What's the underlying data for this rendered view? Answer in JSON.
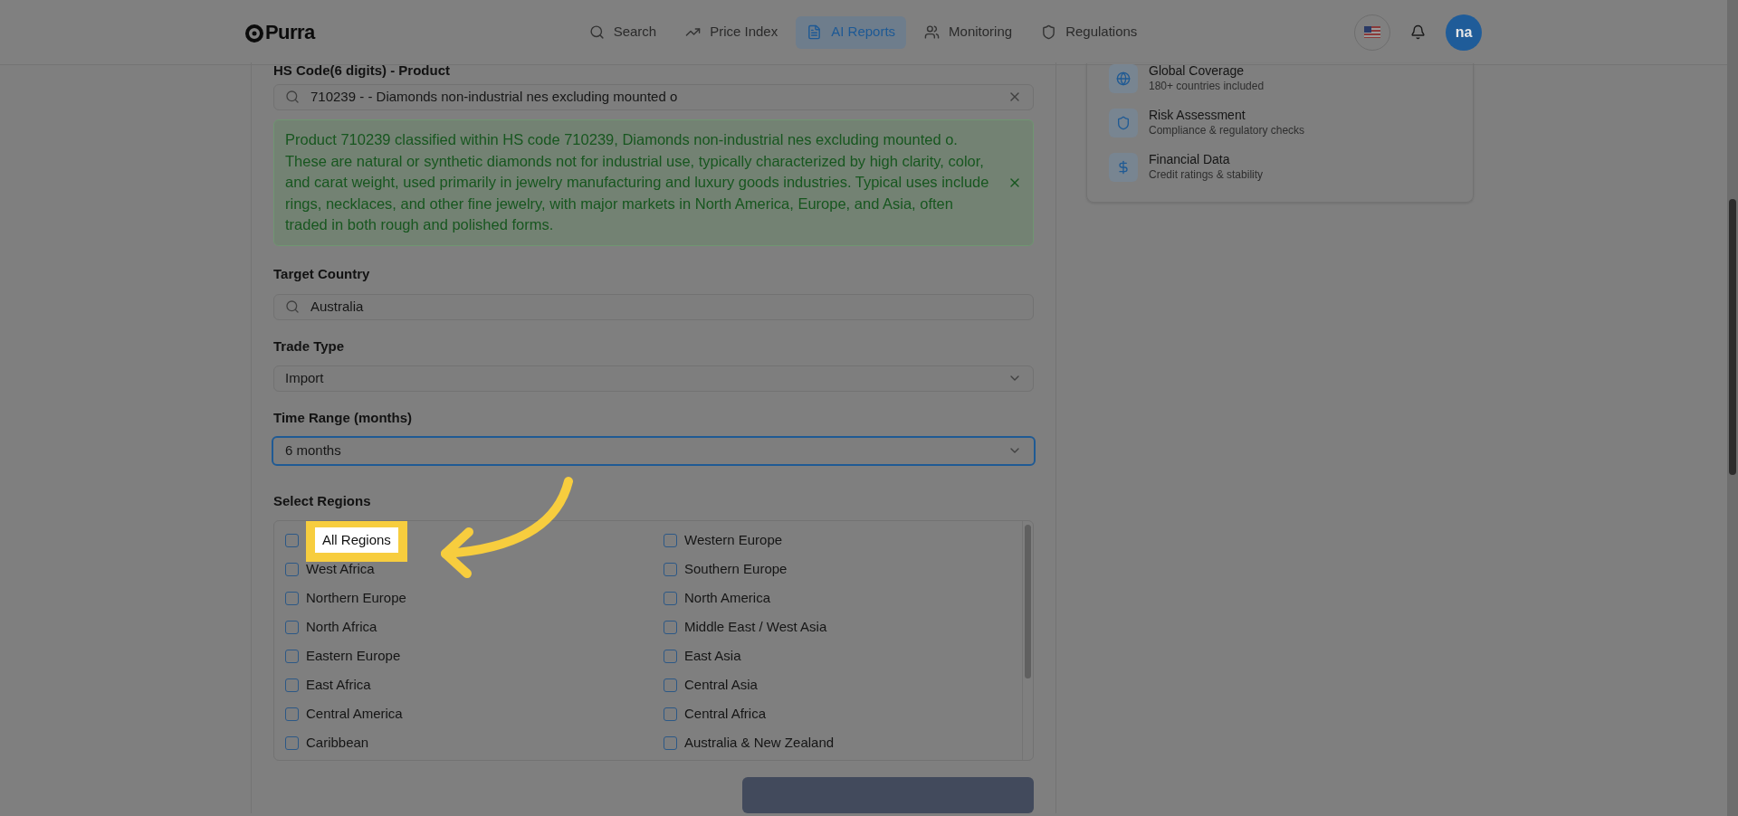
{
  "nav": {
    "logo": "Purra",
    "items": [
      {
        "label": "Search",
        "selected": false
      },
      {
        "label": "Price Index",
        "selected": false
      },
      {
        "label": "AI Reports",
        "selected": true
      },
      {
        "label": "Monitoring",
        "selected": false
      },
      {
        "label": "Regulations",
        "selected": false
      }
    ],
    "avatar": "na"
  },
  "features": [
    {
      "title": "Global Coverage",
      "subtitle": "180+ countries included"
    },
    {
      "title": "Risk Assessment",
      "subtitle": "Compliance & regulatory checks"
    },
    {
      "title": "Financial Data",
      "subtitle": "Credit ratings & stability"
    }
  ],
  "form": {
    "hs_label": "HS Code(6 digits) - Product",
    "hs_value": "710239 - - Diamonds non-industrial nes excluding mounted o",
    "description": "Product 710239 classified within HS code 710239, Diamonds non-industrial nes excluding mounted o. These are natural or synthetic diamonds not for industrial use, typically characterized by high clarity, color, and carat weight, used primarily in jewelry manufacturing and luxury goods industries. Typical uses include rings, necklaces, and other fine jewelry, with major markets in North America, Europe, and Asia, often traded in both rough and polished forms.",
    "country_label": "Target Country",
    "country_value": "Australia",
    "trade_label": "Trade Type",
    "trade_value": "Import",
    "time_label": "Time Range (months)",
    "time_value": "6 months",
    "time_focused": true,
    "regions_label": "Select Regions",
    "regions": [
      {
        "label": "All Regions",
        "checked": false,
        "highlighted": true
      },
      {
        "label": "Western Europe",
        "checked": false,
        "highlighted": false
      },
      {
        "label": "West Africa",
        "checked": false,
        "highlighted": false
      },
      {
        "label": "Southern Europe",
        "checked": false,
        "highlighted": false
      },
      {
        "label": "Northern Europe",
        "checked": false,
        "highlighted": false
      },
      {
        "label": "North America",
        "checked": false,
        "highlighted": false
      },
      {
        "label": "North Africa",
        "checked": false,
        "highlighted": false
      },
      {
        "label": "Middle East / West Asia",
        "checked": false,
        "highlighted": false
      },
      {
        "label": "Eastern Europe",
        "checked": false,
        "highlighted": false
      },
      {
        "label": "East Asia",
        "checked": false,
        "highlighted": false
      },
      {
        "label": "East Africa",
        "checked": false,
        "highlighted": false
      },
      {
        "label": "Central Asia",
        "checked": false,
        "highlighted": false
      },
      {
        "label": "Central America",
        "checked": false,
        "highlighted": false
      },
      {
        "label": "Central Africa",
        "checked": false,
        "highlighted": false
      },
      {
        "label": "Caribbean",
        "checked": false,
        "highlighted": false
      },
      {
        "label": "Australia & New Zealand",
        "checked": false,
        "highlighted": false
      }
    ]
  }
}
